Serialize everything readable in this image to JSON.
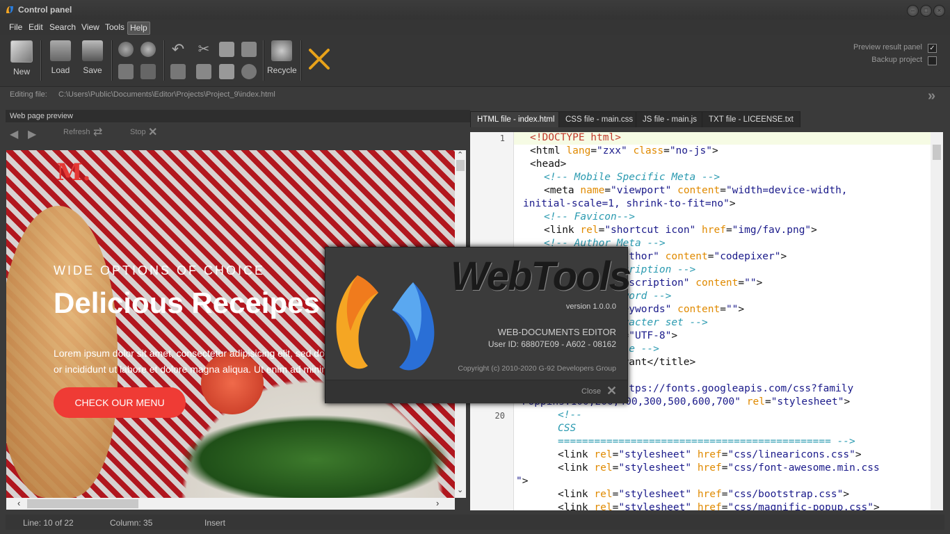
{
  "window": {
    "title": "Control panel"
  },
  "menu": [
    "File",
    "Edit",
    "Search",
    "View",
    "Tools",
    "Help"
  ],
  "toolbar": {
    "new": "New",
    "load": "Load",
    "save": "Save",
    "recycle": "Recycle",
    "preview_result_panel": "Preview result panel",
    "preview_result_checked": true,
    "backup_project": "Backup project",
    "backup_project_checked": false
  },
  "path": {
    "label": "Editing file:",
    "value": "C:\\Users\\Public\\Documents\\Editor\\Projects\\Project_9\\index.html"
  },
  "preview_panel": {
    "title": "Web page preview",
    "refresh": "Refresh",
    "stop": "Stop",
    "site": {
      "logo": "M.",
      "kicker": "WIDE OPTIONS OF CHOICE",
      "headline": "Delicious Receipes",
      "body1": "Lorem ipsum dolor sit amet, consectetur adipisicing elit, sed do",
      "body2": "or incididunt ut labore et dolore magna aliqua. Ut enim ad minim",
      "cta": "CHECK OUR MENU"
    }
  },
  "tabs": [
    {
      "label": "HTML file - index.html",
      "active": true
    },
    {
      "label": "CSS file - main.css",
      "active": false
    },
    {
      "label": "JS file - main.js",
      "active": false
    },
    {
      "label": "TXT file - LICEENSE.txt",
      "active": false
    }
  ],
  "gutter": {
    "line1": "1",
    "line20": "20"
  },
  "status": {
    "line": "Line: 10 of 22",
    "column": "Column: 35",
    "mode": "Insert"
  },
  "dialog": {
    "product": "WebTools",
    "version": "version 1.0.0.0",
    "subtitle": "WEB-DOCUMENTS EDITOR",
    "user_id": "User ID: 68807E09 - A602 - 08162",
    "copyright": "Copyright (c) 2010-2020 G-92 Developers Group",
    "close": "Close"
  },
  "colors": {
    "accent_red": "#e53935",
    "cta_red": "#ef3b35"
  }
}
